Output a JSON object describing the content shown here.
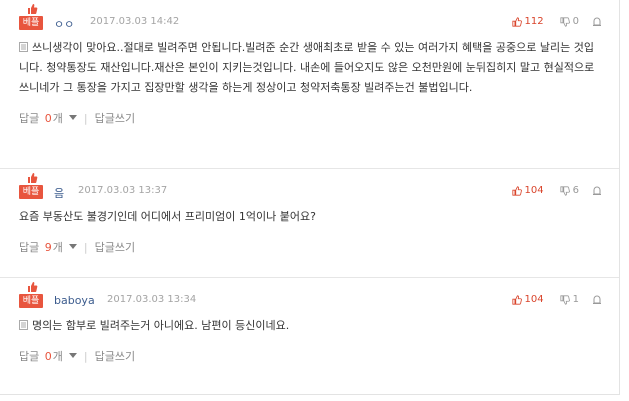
{
  "comments": [
    {
      "badge": "베플",
      "author": "ㅇㅇ",
      "date": "2017.03.03 14:42",
      "likes": "112",
      "dislikes": "0",
      "body": "쓰니생각이 맞아요..절대로 빌려주면 안됩니다.빌려준 순간 생애최초로 받을 수 있는 여러가지 혜택을 공중으로 날리는 것입니다. 청약통장도 재산입니다.재산은 본인이 지키는것입니다. 내손에 들어오지도 않은 오천만원에 눈뒤집히지 말고 현실적으로 쓰니네가 그 통장을 가지고 집장만할 생각을 하는게 정상이고 청약저축통장 빌려주는건 불법입니다.",
      "reply_label": "답글",
      "reply_count": "0",
      "reply_unit": "개",
      "write_reply": "답글쓰기"
    },
    {
      "badge": "베플",
      "author": "음",
      "date": "2017.03.03 13:37",
      "likes": "104",
      "dislikes": "6",
      "body": "요즘 부동산도 불경기인데 어디에서 프리미엄이 1억이나 붙어요?",
      "reply_label": "답글",
      "reply_count": "9",
      "reply_unit": "개",
      "write_reply": "답글쓰기"
    },
    {
      "badge": "베플",
      "author": "baboya",
      "date": "2017.03.03 13:34",
      "likes": "104",
      "dislikes": "1",
      "body": "명의는 함부로 빌려주는거 아니에요. 남편이 등신이네요.",
      "reply_label": "답글",
      "reply_count": "0",
      "reply_unit": "개",
      "write_reply": "답글쓰기"
    }
  ],
  "colors": {
    "accent": "#e8553e",
    "author": "#3c5c8e",
    "meta": "#a4a4a4"
  },
  "icons": {
    "thumb": "thumbs-up-icon",
    "dislike": "thumbs-down-icon",
    "report": "siren-icon",
    "doc": "document-icon",
    "chevron": "chevron-down-icon"
  }
}
